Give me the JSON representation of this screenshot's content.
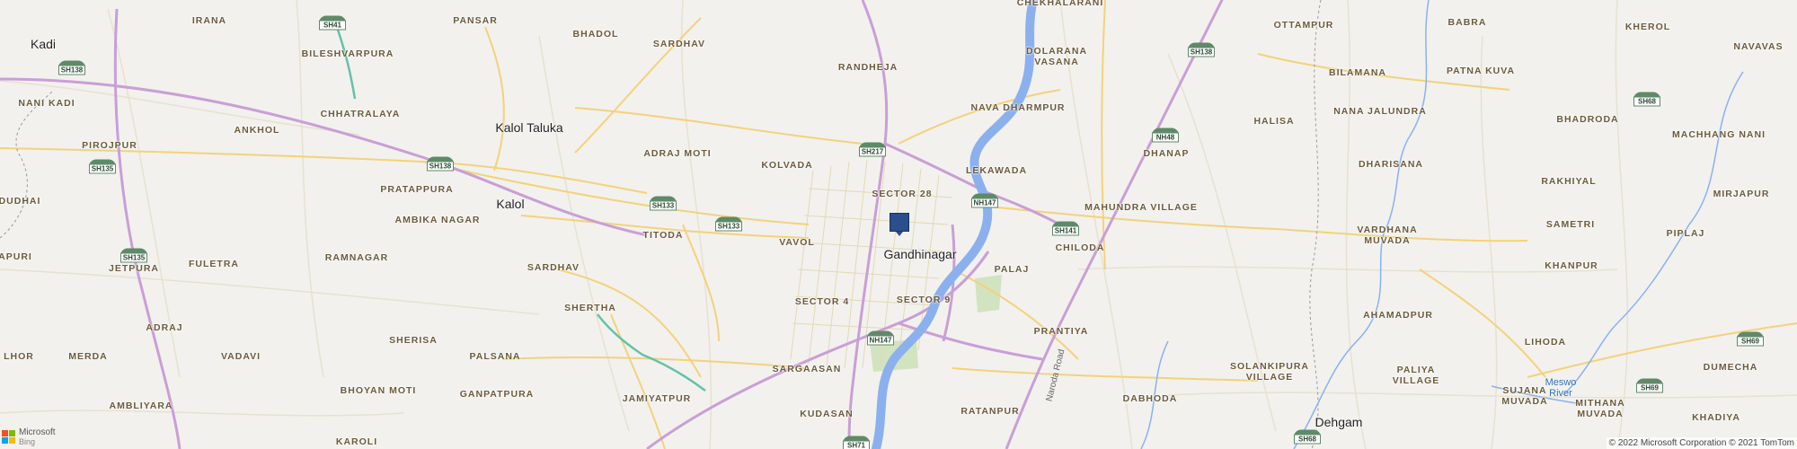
{
  "map": {
    "colors": {
      "background": "#f2f1ee",
      "water": "#8bb0ee",
      "highway": "#c99fd6",
      "major_road": "#f3d27a",
      "minor_road": "#e7e1cf",
      "park": "#d2e3bf",
      "shield": "#5e8a68",
      "pin": "#2b4e8c"
    },
    "pin": {
      "icon": "location-pin-icon",
      "place": "Gandhinagar"
    },
    "towns": [
      "Kadi",
      "Kalol Taluka",
      "Kalol",
      "Gandhinagar",
      "Dehgam"
    ],
    "localities": [
      "IRANA",
      "PANSAR",
      "CHEKHALARANI",
      "OTTAMPUR",
      "BABRA",
      "KHEROL",
      "NAVAVAS",
      "BILESHVARPURA",
      "BHADOL",
      "SARDHAV",
      "RANDHEJA",
      "DOLARANA VASANA",
      "BILAMANA",
      "PATNA KUVA",
      "NANI KADI",
      "CHHATRALAYA",
      "NAVA DHARMPUR",
      "HALISA",
      "NANA JALUNDRA",
      "BHADRODA",
      "ANKHOL",
      "ADRAJ MOTI",
      "DHANAP",
      "MACHHANG NANI",
      "PIROJPUR",
      "KOLVADA",
      "SECTOR 28",
      "LEKAWADA",
      "DHARISANA",
      "RAKHIYAL",
      "DUDHAI",
      "PRATAPPURA",
      "MIRJAPUR",
      "AMBIKA NAGAR",
      "MAHUNDRA VILLAGE",
      "SAMETRI",
      "TITODA",
      "VAVOL",
      "CHILODA",
      "VARDHANA MUVADA",
      "PIPLAJ",
      "APURI",
      "JETPURA",
      "FULETRA",
      "RAMNAGAR",
      "PALAJ",
      "KHANPUR",
      "SARDHAV",
      "SECTOR 4",
      "SECTOR 9",
      "AHAMADPUR",
      "ADRAJ",
      "SHERTHA",
      "PRANTIYA",
      "LIHODA",
      "DUMECHA",
      "LHOR",
      "MERDA",
      "SHERISA",
      "PALSANA",
      "VADAVI",
      "SARGAASAN",
      "SOLANKIPURA VILLAGE",
      "PALIYA VILLAGE",
      "AMBLIYARA",
      "BHOYAN MOTI",
      "GANPATPURA",
      "JAMIYATPUR",
      "KUDASAN",
      "DABHODA",
      "SUJANA MUVADA",
      "MITHANA MUVADA",
      "KHADIYA",
      "KAROLI",
      "RATANPUR"
    ],
    "shields": [
      "SH41",
      "SH138",
      "SH138",
      "SH138",
      "SH135",
      "SH135",
      "SH217",
      "SH133",
      "SH133",
      "NH147",
      "NH147",
      "NH48",
      "SH141",
      "SH68",
      "SH68",
      "SH69",
      "SH69",
      "SH71"
    ],
    "road_names": [
      "Naroda Road"
    ],
    "rivers": [
      "Meswo River"
    ],
    "branding": {
      "logo_icon": "microsoft-bing-logo-icon",
      "line1": "Microsoft",
      "line2": "Bing"
    },
    "attribution": "© 2022 Microsoft Corporation © 2021 TomTom"
  }
}
